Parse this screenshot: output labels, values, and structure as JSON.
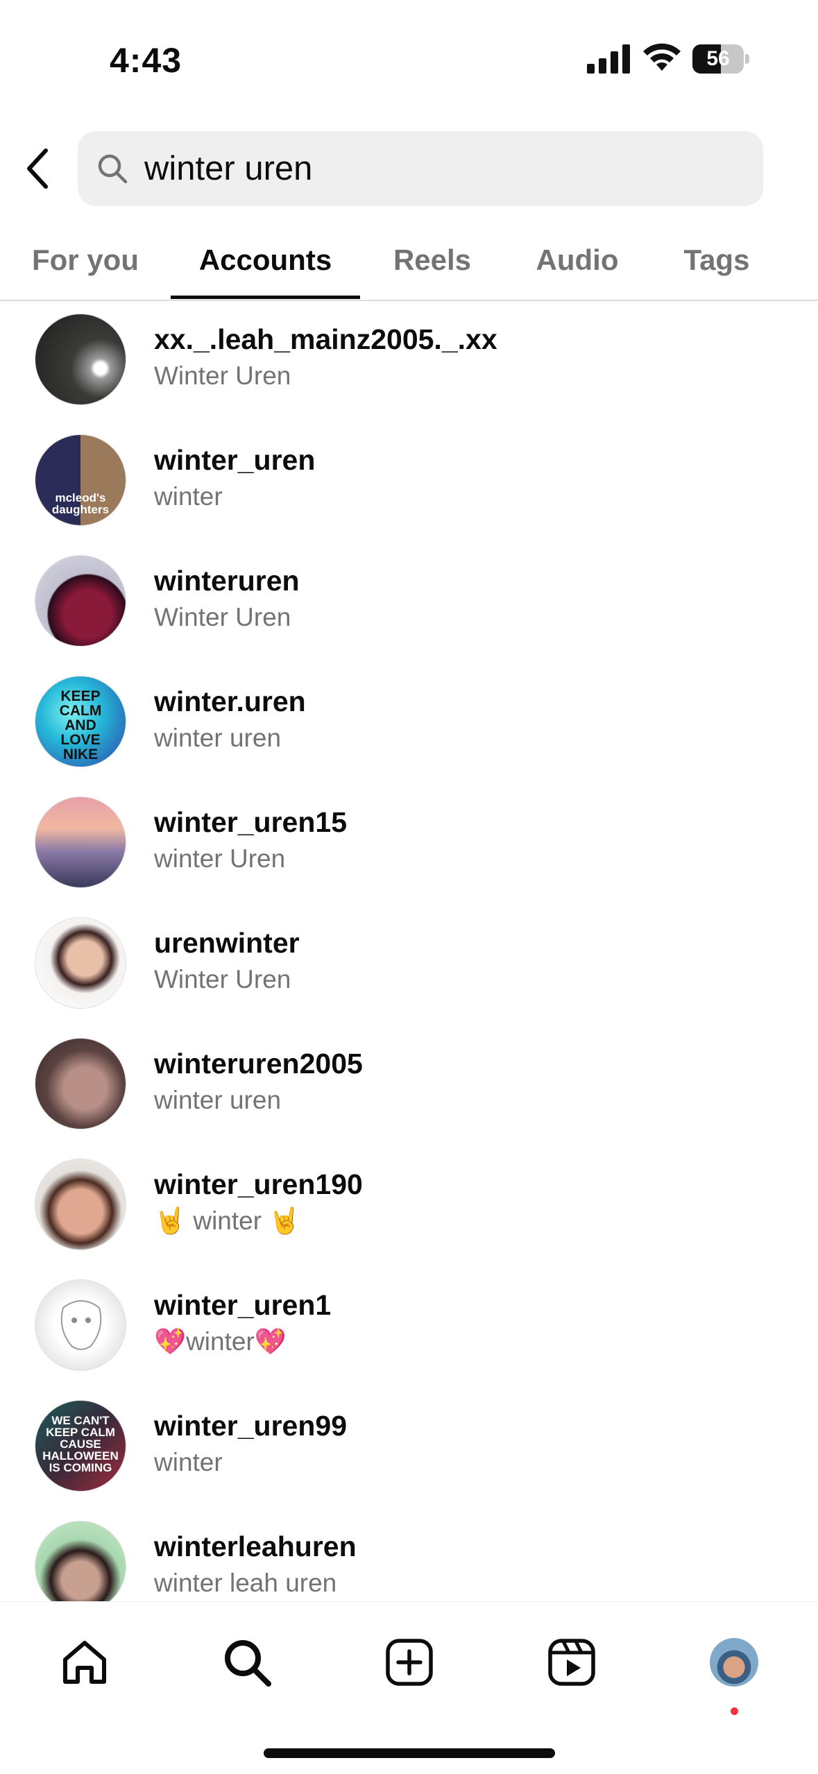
{
  "status_bar": {
    "time": "4:43",
    "battery_percent": "56",
    "battery_level": 0.56
  },
  "search": {
    "query": "winter uren",
    "back_icon": "chevron-left-icon",
    "search_icon": "search-icon"
  },
  "tabs": [
    {
      "label": "For you",
      "active": false
    },
    {
      "label": "Accounts",
      "active": true
    },
    {
      "label": "Reels",
      "active": false
    },
    {
      "label": "Audio",
      "active": false
    },
    {
      "label": "Tags",
      "active": false
    }
  ],
  "results": [
    {
      "username": "xx._.leah_mainz2005._.xx",
      "full_name": "Winter Uren",
      "avatar_colors": [
        "#2b2b2b",
        "#5a5a55"
      ]
    },
    {
      "username": "winter_uren",
      "full_name": "winter",
      "avatar_colors": [
        "#3c3c6a",
        "#8a7a6a"
      ],
      "avatar_text": "mcleod's daughters"
    },
    {
      "username": "winteruren",
      "full_name": "Winter Uren",
      "avatar_colors": [
        "#b8b8c8",
        "#6a1a3a"
      ]
    },
    {
      "username": "winter.uren",
      "full_name": "winter uren",
      "avatar_colors": [
        "#24c8d8",
        "#2a3aa0"
      ],
      "avatar_text": "KEEP CALM AND LOVE NIKE"
    },
    {
      "username": "winter_uren15",
      "full_name": "winter Uren",
      "avatar_colors": [
        "#f0a8a0",
        "#5a4a8a"
      ]
    },
    {
      "username": "urenwinter",
      "full_name": "Winter Uren",
      "avatar_colors": [
        "#f4f2f0",
        "#c89a80"
      ]
    },
    {
      "username": "winteruren2005",
      "full_name": "winter uren",
      "avatar_colors": [
        "#4a3a3a",
        "#b08a80"
      ]
    },
    {
      "username": "winter_uren190",
      "full_name": "🤘 winter 🤘",
      "avatar_colors": [
        "#e8e4e0",
        "#c88a70"
      ]
    },
    {
      "username": "winter_uren1",
      "full_name": "💖winter💖",
      "avatar_colors": [
        "#ffffff",
        "#c8c8c8"
      ]
    },
    {
      "username": "winter_uren99",
      "full_name": "winter",
      "avatar_colors": [
        "#1a5a5a",
        "#a02a3a"
      ],
      "avatar_text": "WE CAN'T KEEP CALM CAUSE HALLOWEEN IS COMING"
    },
    {
      "username": "winterleahuren",
      "full_name": "winter leah uren",
      "avatar_colors": [
        "#a8d8b0",
        "#3a2a2a"
      ]
    }
  ],
  "bottom_nav": [
    {
      "name": "home",
      "icon": "home-icon"
    },
    {
      "name": "search",
      "icon": "search-icon"
    },
    {
      "name": "create",
      "icon": "plus-square-icon"
    },
    {
      "name": "reels",
      "icon": "reels-icon"
    },
    {
      "name": "profile",
      "icon": "profile-avatar"
    }
  ]
}
